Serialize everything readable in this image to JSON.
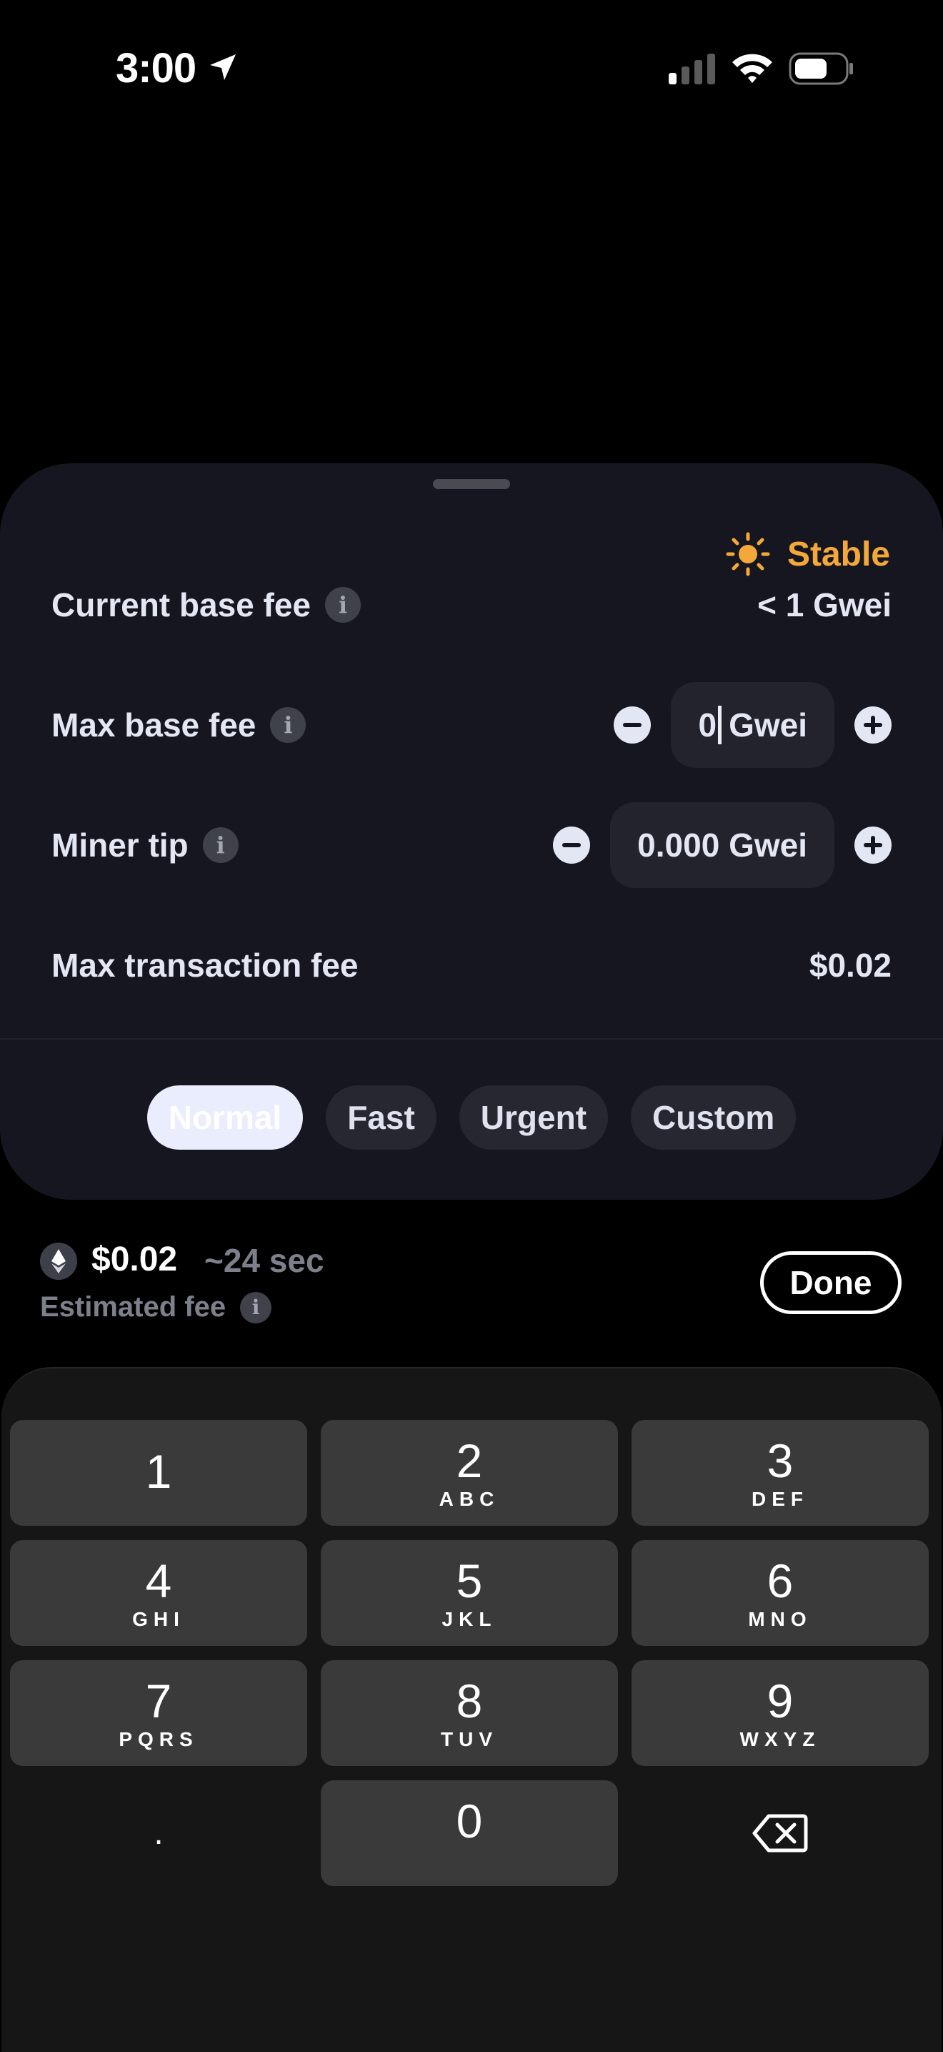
{
  "status_bar": {
    "time": "3:00"
  },
  "sheet": {
    "network_status": "Stable",
    "current_base_fee": {
      "label": "Current base fee",
      "value": "< 1 Gwei"
    },
    "max_base_fee": {
      "label": "Max base fee",
      "value": "0",
      "unit": "Gwei"
    },
    "miner_tip": {
      "label": "Miner tip",
      "value": "0.000 Gwei"
    },
    "max_transaction_fee": {
      "label": "Max transaction fee",
      "value": "$0.02"
    },
    "speed_options": [
      "Normal",
      "Fast",
      "Urgent",
      "Custom"
    ],
    "selected_speed": "Normal"
  },
  "summary": {
    "fee": "$0.02",
    "time": "~24 sec",
    "label": "Estimated fee",
    "done_label": "Done"
  },
  "keypad": {
    "keys": [
      {
        "num": "1",
        "letters": ""
      },
      {
        "num": "2",
        "letters": "ABC"
      },
      {
        "num": "3",
        "letters": "DEF"
      },
      {
        "num": "4",
        "letters": "GHI"
      },
      {
        "num": "5",
        "letters": "JKL"
      },
      {
        "num": "6",
        "letters": "MNO"
      },
      {
        "num": "7",
        "letters": "PQRS"
      },
      {
        "num": "8",
        "letters": "TUV"
      },
      {
        "num": "9",
        "letters": "WXYZ"
      },
      {
        "num": ".",
        "letters": ""
      },
      {
        "num": "0",
        "letters": ""
      }
    ]
  },
  "colors": {
    "accent_status": "#f4a83a",
    "sheet_bg": "#161620",
    "key_bg": "#3a3a3a"
  }
}
